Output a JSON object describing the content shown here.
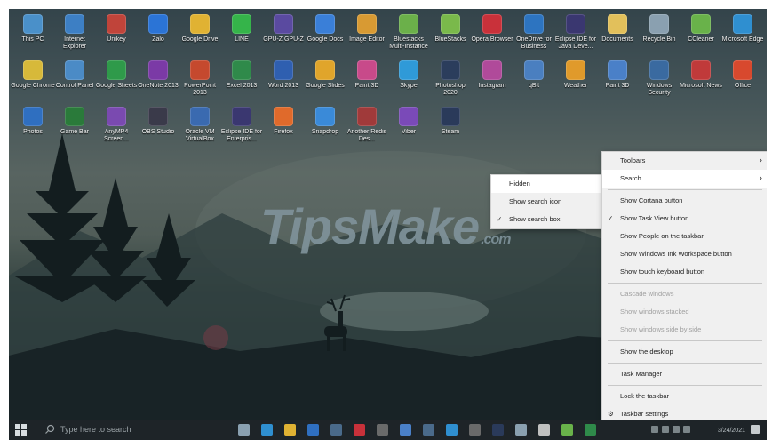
{
  "desktop": {
    "icons_row1": [
      {
        "label": "This PC",
        "color": "#4a90c9"
      },
      {
        "label": "Internet Explorer",
        "color": "#3d7fc4"
      },
      {
        "label": "Unikey",
        "color": "#c0443a"
      },
      {
        "label": "Zalo",
        "color": "#2b74d6"
      },
      {
        "label": "Google Drive",
        "color": "#e0b233"
      },
      {
        "label": "LINE",
        "color": "#35b44a"
      },
      {
        "label": "GPU-Z GPU-Z",
        "color": "#5a4aa0"
      },
      {
        "label": "Google Docs",
        "color": "#3a7fd8"
      },
      {
        "label": "Image Editor",
        "color": "#d89a33"
      },
      {
        "label": "Bluestacks Multi-Instance",
        "color": "#6bb04a"
      },
      {
        "label": "BlueStacks",
        "color": "#7ab94b"
      },
      {
        "label": "Opera Browser",
        "color": "#c9313a"
      },
      {
        "label": "OneDrive for Business",
        "color": "#2d74c0"
      },
      {
        "label": "Eclipse IDE for Java Deve...",
        "color": "#3a3770"
      },
      {
        "label": "Documents",
        "color": "#e2c05b"
      },
      {
        "label": "Recycle Bin",
        "color": "#8aa0b0"
      },
      {
        "label": "CCleaner",
        "color": "#69b24a"
      },
      {
        "label": "Microsoft Edge",
        "color": "#2f8fd0"
      }
    ],
    "icons_row2": [
      {
        "label": "Google Chrome",
        "color": "#d7b93a"
      },
      {
        "label": "Control Panel",
        "color": "#4b8bc6"
      },
      {
        "label": "Google Sheets",
        "color": "#2f9a4a"
      },
      {
        "label": "OneNote 2013",
        "color": "#7b3aa6"
      },
      {
        "label": "PowerPoint 2013",
        "color": "#c5492e"
      },
      {
        "label": "Excel 2013",
        "color": "#2f8a4a"
      },
      {
        "label": "Word 2013",
        "color": "#2f5fb0"
      },
      {
        "label": "Google Slides",
        "color": "#e0a52b"
      },
      {
        "label": "Paint 3D",
        "color": "#c84a8a"
      },
      {
        "label": "Skype",
        "color": "#2f9ad8"
      },
      {
        "label": "Photoshop 2020",
        "color": "#2b3d5c"
      },
      {
        "label": "Instagram",
        "color": "#b04a9a"
      },
      {
        "label": "qBit",
        "color": "#4a7fc0"
      },
      {
        "label": "Weather",
        "color": "#e09a2b"
      },
      {
        "label": "Paint 3D",
        "color": "#4a80c8"
      },
      {
        "label": "Windows Security",
        "color": "#3a6aa0"
      },
      {
        "label": "Microsoft News",
        "color": "#c03a3a"
      },
      {
        "label": "Office",
        "color": "#d8492e"
      }
    ],
    "icons_row3": [
      {
        "label": "Photos",
        "color": "#2f6fc0"
      },
      {
        "label": "Game Bar",
        "color": "#2a7a3a"
      },
      {
        "label": "AnyMP4 Screen...",
        "color": "#7a4ab0"
      },
      {
        "label": "OBS Studio",
        "color": "#3a3a4a"
      },
      {
        "label": "Oracle VM VirtualBox",
        "color": "#3a6ab0"
      },
      {
        "label": "Eclipse IDE for Enterpris...",
        "color": "#3a3770"
      },
      {
        "label": "Firefox",
        "color": "#e06a2b"
      },
      {
        "label": "Snapdrop",
        "color": "#3a8ad8"
      },
      {
        "label": "Another Redis Des...",
        "color": "#a03a3a"
      },
      {
        "label": "Viber",
        "color": "#7a4ab8"
      },
      {
        "label": "Steam",
        "color": "#2a3a5a"
      }
    ],
    "watermark": "TipsMake",
    "watermark_suffix": ".com"
  },
  "context_menu": {
    "items": [
      {
        "label": "Toolbars",
        "check": "",
        "arrow": "›",
        "state": "normal"
      },
      {
        "label": "Search",
        "check": "",
        "arrow": "›",
        "state": "highlight"
      },
      {
        "label": "Show Cortana button",
        "check": "",
        "arrow": "",
        "state": "normal"
      },
      {
        "label": "Show Task View button",
        "check": "✓",
        "arrow": "",
        "state": "normal"
      },
      {
        "label": "Show People on the taskbar",
        "check": "",
        "arrow": "",
        "state": "normal"
      },
      {
        "label": "Show Windows Ink Workspace button",
        "check": "",
        "arrow": "",
        "state": "normal"
      },
      {
        "label": "Show touch keyboard button",
        "check": "",
        "arrow": "",
        "state": "normal"
      },
      {
        "label": "Cascade windows",
        "check": "",
        "arrow": "",
        "state": "disabled"
      },
      {
        "label": "Show windows stacked",
        "check": "",
        "arrow": "",
        "state": "disabled"
      },
      {
        "label": "Show windows side by side",
        "check": "",
        "arrow": "",
        "state": "disabled"
      },
      {
        "label": "Show the desktop",
        "check": "",
        "arrow": "",
        "state": "normal"
      },
      {
        "label": "Task Manager",
        "check": "",
        "arrow": "",
        "state": "normal"
      },
      {
        "label": "Lock the taskbar",
        "check": "",
        "arrow": "",
        "state": "normal"
      },
      {
        "label": "Taskbar settings",
        "check": "⚙",
        "arrow": "",
        "state": "normal"
      }
    ]
  },
  "submenu": {
    "items": [
      {
        "label": "Hidden",
        "check": "",
        "state": "highlight"
      },
      {
        "label": "Show search icon",
        "check": "",
        "state": "normal"
      },
      {
        "label": "Show search box",
        "check": "✓",
        "state": "normal"
      }
    ]
  },
  "taskbar": {
    "search_placeholder": "Type here to search",
    "date": "3/24/2021",
    "pinned_colors": [
      "#8aa0b0",
      "#2f8fd0",
      "#e0b233",
      "#2f6fc0",
      "#4a6a8a",
      "#c9313a",
      "#6a6a6a",
      "#4a80c8",
      "#4a6a8a",
      "#2f8fd0",
      "#6a6a6a",
      "#2a3a5a",
      "#8aa0b0",
      "#c0c0c0",
      "#69b24a",
      "#2f8a4a"
    ]
  }
}
